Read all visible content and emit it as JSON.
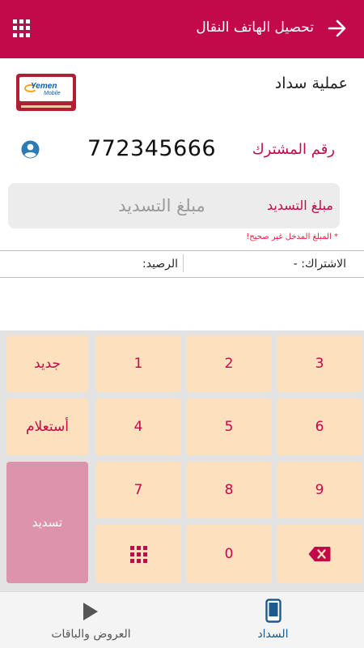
{
  "header": {
    "title": "تحصيل الهاتف النقال",
    "menu_icon": "grid-icon",
    "back_icon": "arrow-right-icon"
  },
  "operation": {
    "title": "عملية سداد",
    "logo_text": "Yemen Mobile"
  },
  "subscriber": {
    "label": "رقم المشترك",
    "number": "772345666",
    "icon": "user-circle-icon"
  },
  "payment_amount": {
    "label": "مبلغ التسديد",
    "placeholder": "مبلغ التسديد",
    "value": ""
  },
  "error_message": "* المبلغ المدخل غير صحيح!",
  "info": {
    "subscription": "الاشتراك: -",
    "balance": "الرصيد:"
  },
  "keypad": {
    "new_label": "جديد",
    "inquiry_label": "أستعلام",
    "pay_label": "تسديد",
    "digits": [
      "1",
      "2",
      "3",
      "4",
      "5",
      "6",
      "7",
      "8",
      "9",
      "0"
    ],
    "grid_icon": "keypad-grid-icon",
    "backspace_icon": "backspace-icon"
  },
  "bottom_nav": {
    "pay_label": "السداد",
    "offers_label": "العروض والباقات",
    "pay_icon": "mobile-phone-icon",
    "offers_icon": "play-icon"
  },
  "colors": {
    "primary": "#c2094a",
    "key_bg": "#fde0bd",
    "pay_key_bg": "#dd93ac",
    "nav_active": "#1d5a8e",
    "error": "#e0213f"
  }
}
